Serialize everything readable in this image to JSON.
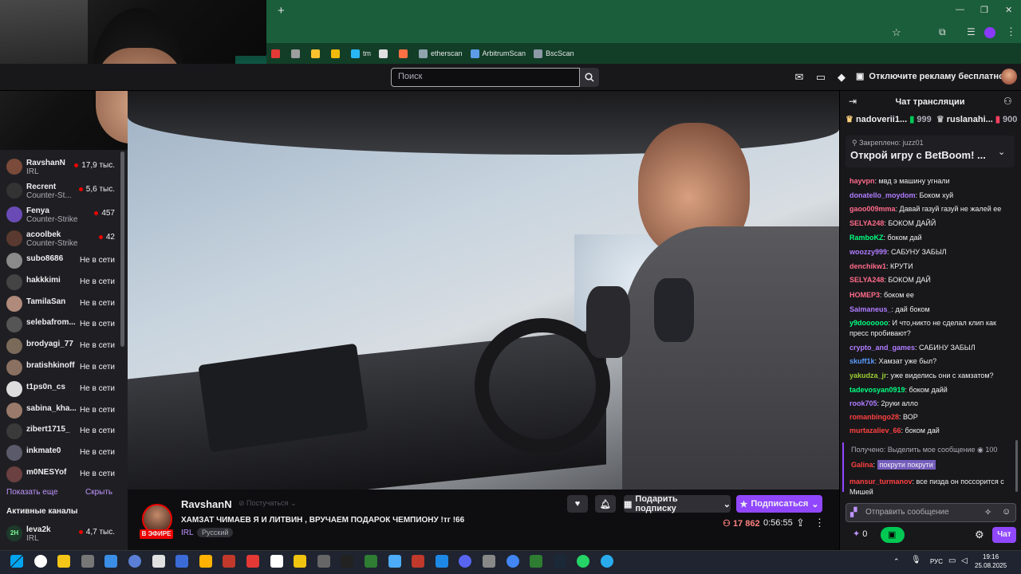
{
  "browser": {
    "new_tab": "+",
    "bookmarks": [
      {
        "label": "",
        "color": "#e53935"
      },
      {
        "label": "",
        "color": "#9e9e9e"
      },
      {
        "label": "",
        "color": "#fbc02d"
      },
      {
        "label": "",
        "color": "#f0b90b"
      },
      {
        "label": "tm",
        "color": "#29b6f6"
      },
      {
        "label": "",
        "color": "#e0e0e0"
      },
      {
        "label": "",
        "color": "#ff7043"
      },
      {
        "label": "etherscan",
        "color": "#90a4ae"
      },
      {
        "label": "ArbitrumScan",
        "color": "#5c9ce6"
      },
      {
        "label": "BscScan",
        "color": "#8d99a6"
      }
    ]
  },
  "nav": {
    "search_placeholder": "Поиск",
    "ad_free": "Отключите рекламу бесплатно"
  },
  "sidebar": {
    "channels": [
      {
        "name": "RavshanN",
        "category": "IRL",
        "viewers": "17,9 тыс.",
        "avatar": "#7a4a3a"
      },
      {
        "name": "Recrent",
        "category": "Counter-St...",
        "viewers": "5,6 тыс.",
        "avatar": "#333333"
      },
      {
        "name": "Fenya",
        "category": "Counter-Strike",
        "viewers": "457",
        "avatar": "#6a4bb5"
      },
      {
        "name": "acoolbek",
        "category": "Counter-Strike",
        "viewers": "42",
        "avatar": "#5a3a30"
      }
    ],
    "offline": [
      {
        "name": "subo8686",
        "status": "Не в сети",
        "avatar": "#8a8a8a"
      },
      {
        "name": "hakkkimi",
        "status": "Не в сети",
        "avatar": "#444444"
      },
      {
        "name": "TamilaSan",
        "status": "Не в сети",
        "avatar": "#b08a7a"
      },
      {
        "name": "selebafrom...",
        "status": "Не в сети",
        "avatar": "#555555"
      },
      {
        "name": "brodyagi_77",
        "status": "Не в сети",
        "avatar": "#7a6a5a"
      },
      {
        "name": "bratishkinoff",
        "status": "Не в сети",
        "avatar": "#8a7060"
      },
      {
        "name": "t1ps0n_cs",
        "status": "Не в сети",
        "avatar": "#dddddd"
      },
      {
        "name": "sabina_kha...",
        "status": "Не в сети",
        "avatar": "#9a7a6a"
      },
      {
        "name": "zibert1715_",
        "status": "Не в сети",
        "avatar": "#3a3a3a"
      },
      {
        "name": "inkmate0",
        "status": "Не в сети",
        "avatar": "#5a5a6a"
      },
      {
        "name": "m0NESYof",
        "status": "Не в сети",
        "avatar": "#6a4040"
      }
    ],
    "show_more": "Показать еще",
    "hide": "Скрыть",
    "active_heading": "Активные каналы",
    "active": {
      "name": "leva2k",
      "category": "IRL",
      "viewers": "4,7 тыс.",
      "badge": "2H"
    }
  },
  "stream": {
    "streamer": "RavshanN",
    "knock": "Постучаться",
    "title": "ХАМЗАТ ЧИМАЕВ Я И ЛИТВИН , ВРУЧАЕМ ПОДАРОК ЧЕМПИОНУ !тг !66",
    "category": "IRL",
    "language": "Русский",
    "live": "В ЭФИРЕ",
    "gift_sub": "Подарить подписку",
    "subscribe": "Подписаться",
    "viewers": "17 862",
    "uptime": "0:56:55"
  },
  "chat": {
    "header": "Чат трансляции",
    "leaders": [
      {
        "name": "nadoverii1...",
        "amount": "999"
      },
      {
        "name": "ruslanahi...",
        "amount": "900"
      }
    ],
    "pinned_label": "Закреплено: juzz01",
    "pinned_text": "Открой игру с BetBoom! ...",
    "messages": [
      {
        "user": "hayvpn",
        "text": ": мвд э машину угнали",
        "color": "#ff6b8a"
      },
      {
        "user": "donatello_moydom",
        "text": ": Боком хуй",
        "color": "#b07cff"
      },
      {
        "user": "gaoo009mma",
        "text": ": Давай газуй газуй не жалей ее",
        "color": "#ff6b8a"
      },
      {
        "user": "SELYA248",
        "text": ": БОКОМ ДАЙЙ",
        "color": "#ff6b8a"
      },
      {
        "user": "RamboKZ",
        "text": ": боком дай",
        "color": "#00ff7f"
      },
      {
        "user": "woozzy999",
        "text": ": САБУНУ ЗАБЫЛ",
        "color": "#b07cff"
      },
      {
        "user": "denchikw1",
        "text": ": КРУТИ",
        "color": "#ff6b8a"
      },
      {
        "user": "SELYA248",
        "text": ": БОКОМ ДАЙ",
        "color": "#ff6b8a"
      },
      {
        "user": "HOMEP3",
        "text": ": боком ее",
        "color": "#ff6b8a"
      },
      {
        "user": "Saimaneus_",
        "text": ": дай боком",
        "color": "#b07cff"
      },
      {
        "user": "y9doooooo",
        "text": ": И что,никто не сделал клип как пресс пробивают?",
        "color": "#00ff7f"
      },
      {
        "user": "crypto_and_games",
        "text": ": САБИНУ ЗАБЫЛ",
        "color": "#b07cff"
      },
      {
        "user": "skuff1k",
        "text": ": Хамзат уже был?",
        "color": "#5c9cff"
      },
      {
        "user": "yakudza_jr",
        "text": ": уже виделись они с хамзатом?",
        "color": "#9acd32"
      },
      {
        "user": "tadevosyan0919",
        "text": ": боком дайй",
        "color": "#00ff7f"
      },
      {
        "user": "rook705",
        "text": ": 2руки алло",
        "color": "#b07cff"
      },
      {
        "user": "romanbingo28",
        "text": ": ВОР",
        "color": "#ff4040"
      },
      {
        "user": "murtazaliev_66",
        "text": ": боком дай",
        "color": "#ff4040"
      }
    ],
    "highlight_label": "Получено: Выделить мое сообщение",
    "highlight_points": "100",
    "highlight_user": "Galina",
    "highlight_text": "покрути покрути",
    "last_user": "mansur_turmanov",
    "last_text": ": все пизда он поссорится с Мишей",
    "input_placeholder": "Отправить сообщение",
    "points": "0",
    "chat_button": "Чат"
  },
  "taskbar": {
    "lang": "РУС",
    "time": "19:16",
    "date": "25.08.2025"
  }
}
